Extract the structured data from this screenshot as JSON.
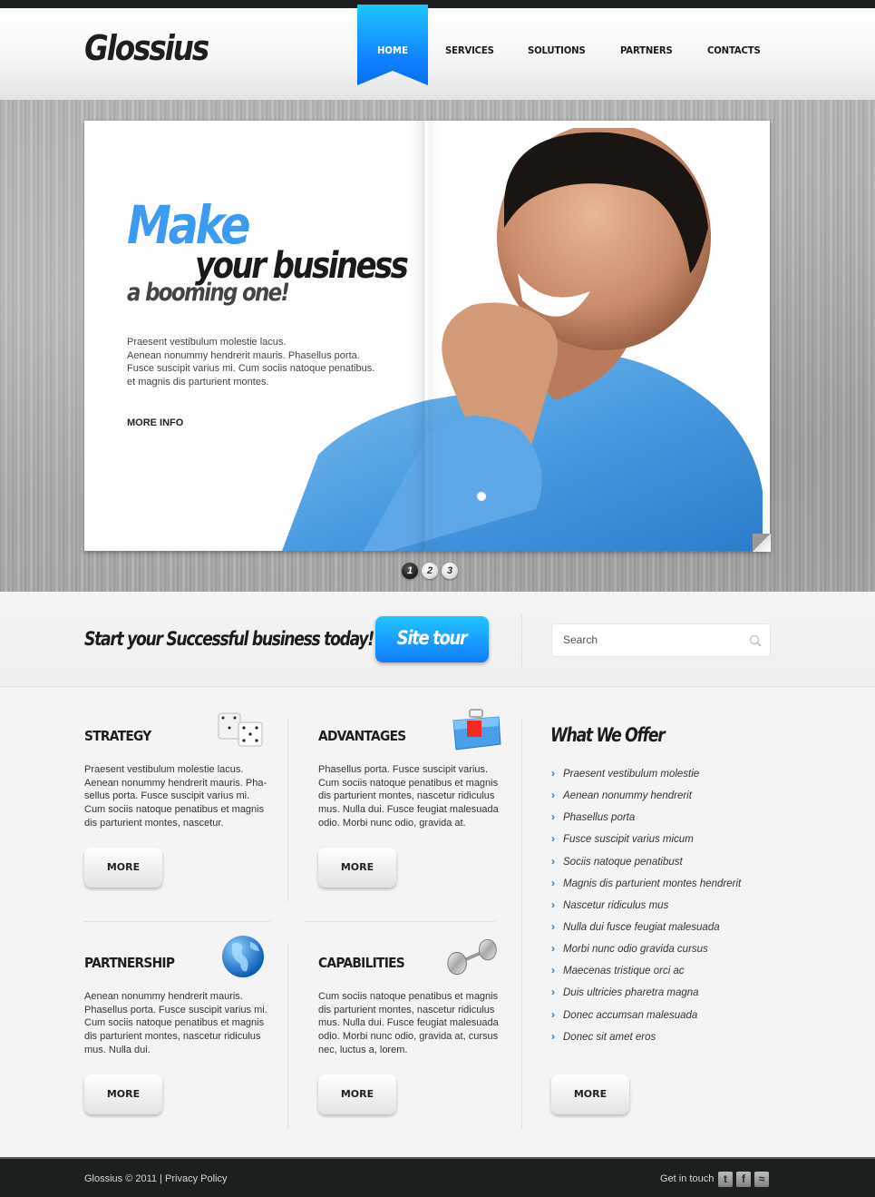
{
  "header": {
    "logo": "Glossius",
    "nav": [
      {
        "label": "HOME",
        "active": true
      },
      {
        "label": "SERVICES"
      },
      {
        "label": "SOLUTIONS"
      },
      {
        "label": "PARTNERS"
      },
      {
        "label": "CONTACTS"
      }
    ]
  },
  "hero": {
    "headline_1": "Make",
    "headline_2": "your business",
    "headline_3": "a booming one!",
    "text_lines": [
      "Praesent vestibulum molestie lacus.",
      "Aenean nonummy hendrerit mauris. Phasellus porta.",
      "Fusce suscipit varius mi. Cum sociis natoque penatibus.",
      "et magnis dis parturient montes."
    ],
    "more_info": "MORE INFO",
    "image": "smiling-man-in-blue-shirt",
    "slides": [
      "1",
      "2",
      "3"
    ],
    "active_slide": 1
  },
  "cta": {
    "text": "Start your Successful business today!",
    "button": "Site tour",
    "search_placeholder": "Search"
  },
  "boxes": [
    {
      "title": "STRATEGY",
      "icon": "dice-icon",
      "text": "Praesent vestibulum molestie lacus. Aenean nonummy hendrerit mauris. Pha-sellus porta. Fusce suscipit varius mi. Cum sociis natoque penatibus et magnis dis parturient montes, nascetur.",
      "button": "MORE"
    },
    {
      "title": "ADVANTAGES",
      "icon": "toolbox-icon",
      "text": "Phasellus porta. Fusce suscipit varius. Cum sociis natoque penatibus et magnis dis parturient montes, nascetur ridiculus mus. Nulla dui. Fusce feugiat malesuada odio. Morbi nunc odio, gravida at.",
      "button": "MORE"
    },
    {
      "title": "PARTNERSHIP",
      "icon": "globe-icon",
      "text": "Aenean nonummy hendrerit mauris. Phasellus porta. Fusce suscipit varius mi. Cum sociis natoque penatibus et magnis dis parturient montes, nascetur ridiculus mus. Nulla dui.",
      "button": "MORE"
    },
    {
      "title": "CAPABILITIES",
      "icon": "dumbbell-icon",
      "text": "Cum sociis natoque penatibus et magnis dis parturient montes, nascetur ridiculus mus. Nulla dui. Fusce feugiat malesuada odio. Morbi nunc odio, gravida at, cursus nec, luctus a, lorem.",
      "button": "MORE"
    }
  ],
  "offer": {
    "title": "What We Offer",
    "items": [
      "Praesent vestibulum molestie",
      "Aenean nonummy hendrerit",
      "Phasellus porta",
      "Fusce suscipit varius micum",
      "Sociis natoque penatibust",
      "Magnis dis parturient montes  hendrerit",
      "Nascetur ridiculus mus",
      "Nulla dui fusce feugiat malesuada",
      "Morbi nunc odio gravida cursus",
      "Maecenas tristique orci ac",
      "Duis ultricies pharetra magna",
      "Donec accumsan malesuada",
      "Donec sit amet eros"
    ],
    "button": "MORE"
  },
  "footer": {
    "copyright": "Glossius © 2011 | ",
    "privacy": "Privacy Policy",
    "get_in_touch": "Get in touch",
    "social": [
      {
        "name": "twitter",
        "glyph": "t"
      },
      {
        "name": "facebook",
        "glyph": "f"
      },
      {
        "name": "rss",
        "glyph": "≈"
      }
    ]
  },
  "colors": {
    "accent": "#1a8cff",
    "dark": "#1c1f1f",
    "headline_blue": "#3b9bf3"
  }
}
